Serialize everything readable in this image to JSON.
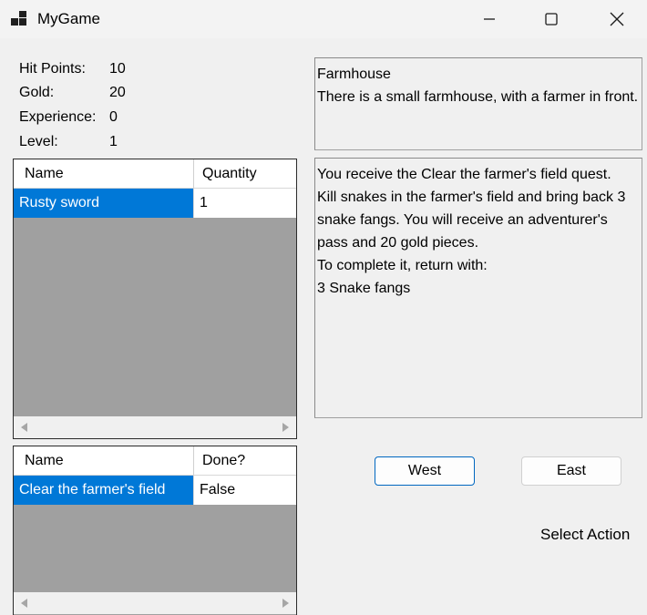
{
  "window": {
    "title": "MyGame",
    "controls": [
      "minimize-icon",
      "maximize-icon",
      "close-icon"
    ]
  },
  "stats": {
    "hit_points_label": "Hit Points:",
    "hit_points": "10",
    "gold_label": "Gold:",
    "gold": "20",
    "experience_label": "Experience:",
    "experience": "0",
    "level_label": "Level:",
    "level": "1"
  },
  "inventory": {
    "headers": [
      "Name",
      "Quantity"
    ],
    "rows": [
      {
        "name": "Rusty sword",
        "quantity": "1"
      }
    ]
  },
  "quests": {
    "headers": [
      "Name",
      "Done?"
    ],
    "rows": [
      {
        "name": "Clear the farmer's field",
        "done": "False"
      }
    ]
  },
  "location": {
    "lines": [
      "Farmhouse",
      "There is a small farmhouse, with a farmer in front."
    ]
  },
  "messages": {
    "lines": [
      "You receive the Clear the farmer's field quest.",
      "Kill snakes in the farmer's field and bring back 3 snake fangs. You will receive an adventurer's pass and 20 gold pieces.",
      "To complete it, return with:",
      "3 Snake fangs"
    ]
  },
  "buttons": {
    "west": "West",
    "east": "East"
  },
  "status": {
    "select_action": "Select Action"
  },
  "colors": {
    "selection": "#0078d7",
    "grid_background": "#a0a0a0",
    "window_background": "#f0f0f0"
  }
}
